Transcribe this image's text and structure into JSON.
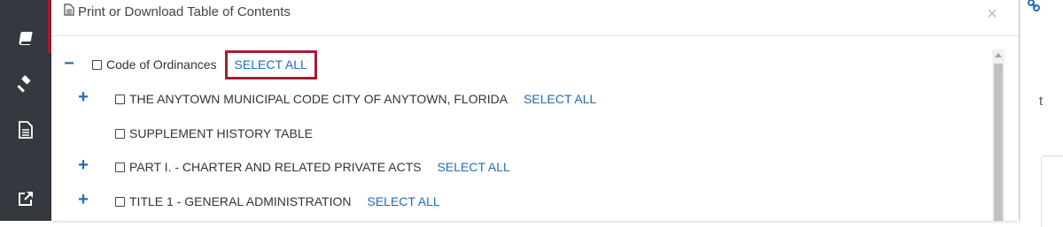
{
  "modal": {
    "title": "Print or Download Table of Contents",
    "close_symbol": "×"
  },
  "tree": {
    "root": {
      "toggle": "−",
      "label": "Code of Ordinances",
      "select_all": "SELECT ALL"
    },
    "items": [
      {
        "toggle": "+",
        "label": "THE ANYTOWN MUNICIPAL CODE CITY OF ANYTOWN, FLORIDA",
        "select_all": "SELECT ALL"
      },
      {
        "toggle": "",
        "label": "SUPPLEMENT HISTORY TABLE",
        "select_all": ""
      },
      {
        "toggle": "+",
        "label": "PART I. - CHARTER AND RELATED PRIVATE ACTS",
        "select_all": "SELECT ALL"
      },
      {
        "toggle": "+",
        "label": "TITLE 1 - GENERAL ADMINISTRATION",
        "select_all": "SELECT ALL"
      }
    ]
  },
  "sidebar": {
    "icons": [
      "book-icon",
      "gavel-icon",
      "document-icon",
      "external-link-icon"
    ]
  },
  "right_panel": {
    "fragment_text": "t"
  },
  "colors": {
    "accent": "#a31f34",
    "link": "#1f6cb8",
    "sidebar_bg": "#33393f"
  }
}
